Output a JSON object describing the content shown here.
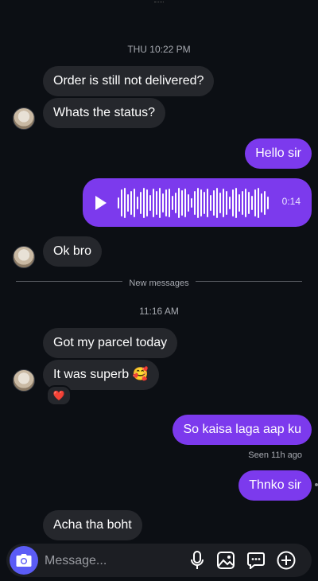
{
  "timestamps": {
    "first": "THU 10:22 PM",
    "second": "11:16 AM"
  },
  "messages": {
    "m1": "Order is still not delivered?",
    "m2": "Whats the status?",
    "m3": "Hello sir",
    "m4": "Ok bro",
    "m5": "Got my parcel today",
    "m6": "It was superb 🥰",
    "m7": "So kaisa laga aap ku",
    "m8": "Thnko sir",
    "m9": "Acha tha boht"
  },
  "voice_note": {
    "duration": "0:14"
  },
  "new_messages_label": "New messages",
  "reaction": "❤️",
  "seen_status": "Seen 11h ago",
  "composer": {
    "placeholder": "Message..."
  },
  "colors": {
    "outgoing": "#7c3aed",
    "incoming": "#25272c",
    "camera": "#5b5cf6"
  },
  "icons": [
    "play-icon",
    "camera-icon",
    "microphone-icon",
    "gallery-icon",
    "sticker-icon",
    "plus-icon"
  ]
}
